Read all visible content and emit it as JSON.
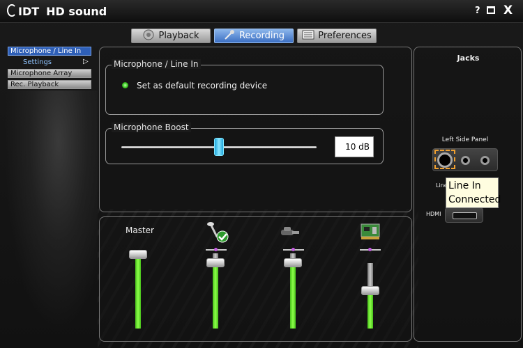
{
  "app": {
    "brand_company": "IDT",
    "brand_hd": "HD",
    "brand_sound": "sound",
    "help_label": "?",
    "minimize_label": "▭",
    "close_label": "X"
  },
  "tabs": [
    {
      "label": "Playback",
      "active": false,
      "icon": "speaker-icon"
    },
    {
      "label": "Recording",
      "active": true,
      "icon": "microphone-icon"
    },
    {
      "label": "Preferences",
      "active": false,
      "icon": "list-icon"
    }
  ],
  "sidebar": {
    "items": [
      {
        "label": "Microphone / Line In",
        "selected": true
      },
      {
        "label": "Microphone Array",
        "selected": false
      },
      {
        "label": "Rec. Playback",
        "selected": false
      }
    ],
    "sub_item": "Settings",
    "sub_arrow": "▷"
  },
  "settings": {
    "group_title": "Microphone / Line In",
    "default_device_label": "Set as default recording device",
    "boost_title": "Microphone Boost",
    "boost_value": "10 dB",
    "boost_fraction": 0.5
  },
  "mixer": {
    "master_label": "Master",
    "channels": [
      {
        "name": "master",
        "level": 0.98
      },
      {
        "name": "microphone",
        "level": 0.87
      },
      {
        "name": "line-in",
        "level": 0.87
      },
      {
        "name": "pc-card",
        "level": 0.5
      }
    ]
  },
  "jacks": {
    "title": "Jacks",
    "panel_label": "Left Side Panel",
    "line_label_partial": "Line",
    "hdmi_label": "HDMI",
    "tooltip_line1": "Line In",
    "tooltip_line2": "Connected"
  },
  "colors": {
    "accent": "#2e5fb7",
    "led_green": "#3ecb24",
    "fader_green": "#6fe02e",
    "slider_cyan": "#39c0ee",
    "jack_highlight": "#f0a030"
  }
}
